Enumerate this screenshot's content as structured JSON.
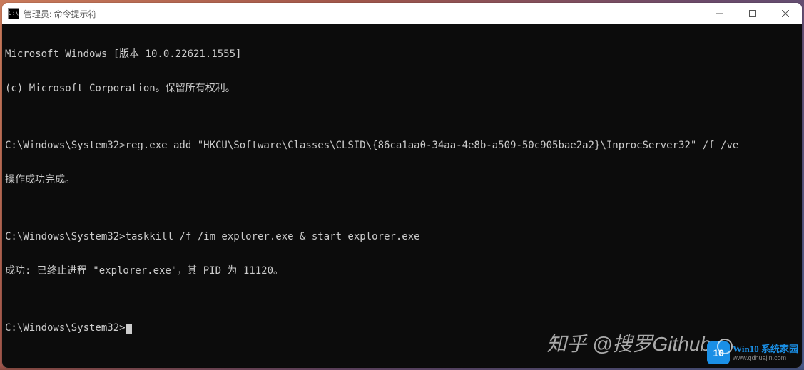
{
  "window": {
    "title": "管理员: 命令提示符",
    "icon_label": "C:\\"
  },
  "terminal": {
    "lines": [
      "Microsoft Windows [版本 10.0.22621.1555]",
      "(c) Microsoft Corporation。保留所有权利。",
      "",
      "C:\\Windows\\System32>reg.exe add \"HKCU\\Software\\Classes\\CLSID\\{86ca1aa0-34aa-4e8b-a509-50c905bae2a2}\\InprocServer32\" /f /ve",
      "操作成功完成。",
      "",
      "C:\\Windows\\System32>taskkill /f /im explorer.exe & start explorer.exe",
      "成功: 已终止进程 \"explorer.exe\"，其 PID 为 11120。",
      "",
      "C:\\Windows\\System32>"
    ]
  },
  "watermarks": {
    "zhihu": "知乎 @搜罗Github",
    "badge_num": "10",
    "badge_title": "Win10 系统家园",
    "badge_url": "www.qdhuajin.com"
  }
}
